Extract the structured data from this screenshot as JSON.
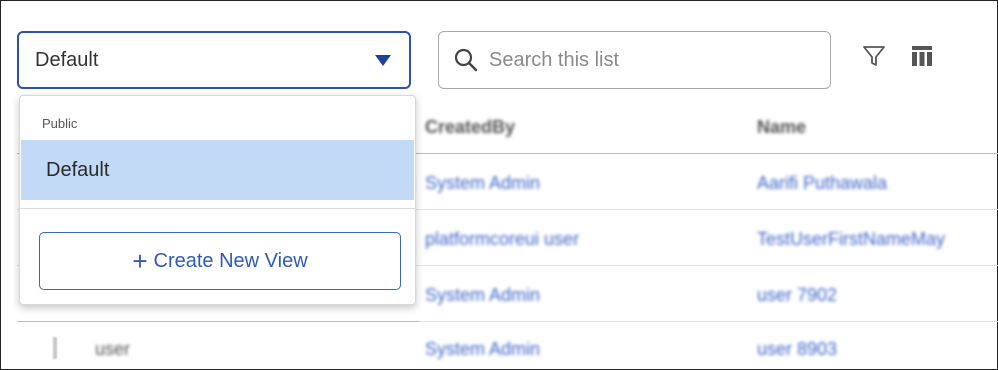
{
  "view_selector": {
    "selected": "Default",
    "caret_icon": "caret-down-icon"
  },
  "search": {
    "placeholder": "Search this list",
    "value": "",
    "icon": "search-icon"
  },
  "toolbar": {
    "filter_icon": "filter-icon",
    "columns_icon": "columns-icon"
  },
  "dropdown": {
    "group_label": "Public",
    "options": [
      {
        "label": "Default",
        "selected": true
      }
    ],
    "create_button_label": "Create New View",
    "create_button_icon": "plus-icon"
  },
  "table": {
    "columns": [
      "CreatedBy",
      "Name"
    ],
    "rows": [
      {
        "first": "",
        "created_by": "System Admin",
        "name": "Aarifi Puthawala"
      },
      {
        "first": "",
        "created_by": "platformcoreui user",
        "name": "TestUserFirstNameMay"
      },
      {
        "first": "",
        "created_by": "System Admin",
        "name": "user 7902"
      },
      {
        "first": "user",
        "created_by": "System Admin",
        "name": "user 8903"
      }
    ]
  },
  "colors": {
    "accent": "#2d4fb8",
    "selected_bg": "#c2daf6",
    "link": "#3f66c7"
  }
}
